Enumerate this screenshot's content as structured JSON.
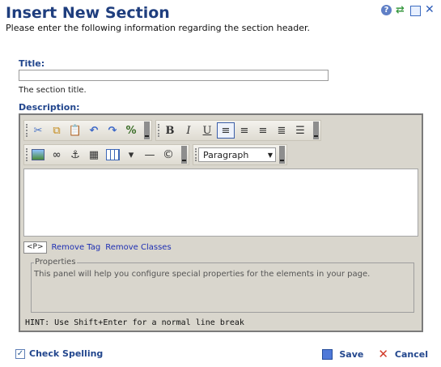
{
  "dialog": {
    "title": "Insert New Section",
    "subtitle": "Please enter the following information regarding the section header."
  },
  "header_icons": [
    "help-icon",
    "refresh-icon",
    "maximize-icon",
    "close-icon"
  ],
  "form": {
    "title_label": "Title:",
    "title_value": "",
    "title_help": "The section title.",
    "description_label": "Description:"
  },
  "editor": {
    "toolbar_row1": [
      "cut-icon",
      "copy-icon",
      "paste-icon",
      "undo-icon",
      "redo-icon",
      "format-icon",
      "bold-icon",
      "italic-icon",
      "underline-icon",
      "align-left-icon",
      "align-center-icon",
      "align-right-icon",
      "justify-icon",
      "ordered-list-icon"
    ],
    "toolbar_row2": [
      "image-icon",
      "link-icon",
      "anchor-icon",
      "media-icon",
      "table-icon",
      "horizontal-rule-icon",
      "copyright-icon"
    ],
    "format_select": "Paragraph",
    "content": "",
    "tag_chip": "<P>",
    "remove_tag": "Remove Tag",
    "remove_classes": "Remove Classes",
    "properties_title": "Properties",
    "properties_text": "This panel will help you configure special properties for the elements in your page.",
    "hint": "HINT: Use Shift+Enter for a normal line break"
  },
  "footer": {
    "check_spelling": "Check Spelling",
    "save": "Save",
    "cancel": "Cancel"
  },
  "colors": {
    "title_blue": "#1f3e7e",
    "label_blue": "#22468d",
    "editor_bg": "#d9d6cd",
    "cancel_red": "#d23c2b"
  }
}
